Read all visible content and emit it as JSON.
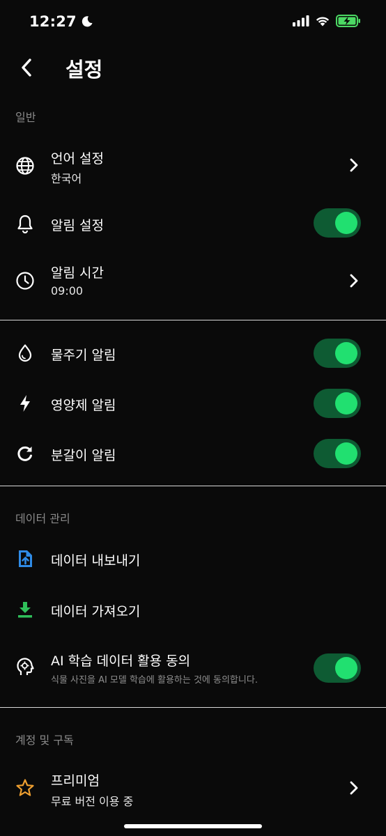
{
  "status_bar": {
    "time": "12:27",
    "moon_icon": "moon-icon",
    "signal_icon": "cellular-signal-icon",
    "wifi_icon": "wifi-icon",
    "battery_icon": "battery-charging-icon",
    "battery_color": "#4cd964"
  },
  "header": {
    "back_icon": "chevron-left-icon",
    "title": "설정"
  },
  "sections": {
    "general": {
      "label": "일반"
    },
    "data": {
      "label": "데이터 관리"
    },
    "account": {
      "label": "계정 및 구독"
    }
  },
  "settings": {
    "language": {
      "icon": "globe-icon",
      "title": "언어 설정",
      "value": "한국어"
    },
    "notifications": {
      "icon": "bell-icon",
      "title": "알림 설정",
      "enabled": true
    },
    "notification_time": {
      "icon": "clock-icon",
      "title": "알림 시간",
      "value": "09:00"
    },
    "watering": {
      "icon": "water-drop-icon",
      "title": "물주기 알림",
      "enabled": true
    },
    "fertilizer": {
      "icon": "lightning-icon",
      "title": "영양제 알림",
      "enabled": true
    },
    "repotting": {
      "icon": "refresh-icon",
      "title": "분갈이 알림",
      "enabled": true
    },
    "export": {
      "icon": "file-upload-icon",
      "title": "데이터 내보내기",
      "icon_color": "#2f8be6"
    },
    "import": {
      "icon": "download-icon",
      "title": "데이터 가져오기",
      "icon_color": "#2fbf5a"
    },
    "ai_consent": {
      "icon": "ai-head-icon",
      "title": "AI 학습 데이터 활용 동의",
      "description": "식물 사진을 AI 모델 학습에 활용하는 것에 동의합니다.",
      "enabled": true
    },
    "premium": {
      "icon": "star-icon",
      "title": "프리미엄",
      "value": "무료 버전 이용 중",
      "icon_color": "#f0a030"
    }
  },
  "colors": {
    "background": "#0a0a0a",
    "toggle_track": "#0e5b33",
    "toggle_knob": "#21e070",
    "section_label": "#8a8a8a"
  }
}
